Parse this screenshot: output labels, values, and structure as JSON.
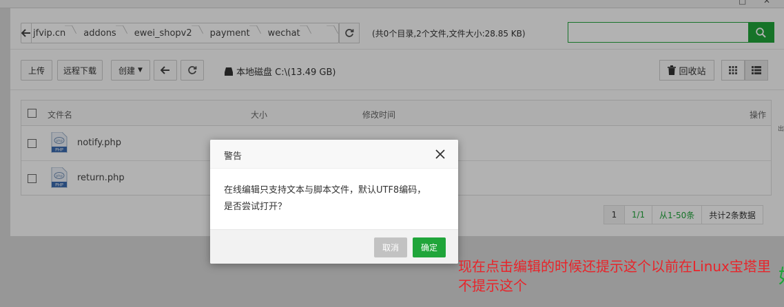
{
  "window": {
    "controls": [
      "□",
      "✕"
    ]
  },
  "path": {
    "crumbs": [
      "jfvip.cn",
      "addons",
      "ewei_shopv2",
      "payment",
      "wechat"
    ],
    "info": "(共0个目录,2个文件,文件大小:28.85 KB)",
    "search_placeholder": ""
  },
  "toolbar": {
    "upload": "上传",
    "remote_download": "远程下载",
    "create": "创建",
    "disk": "本地磁盘 C:\\(13.49 GB)",
    "recycle": "回收站"
  },
  "table": {
    "headers": {
      "name": "文件名",
      "size": "大小",
      "mtime": "修改时间",
      "ops": "操作"
    },
    "rows": [
      {
        "name": "notify.php"
      },
      {
        "name": "return.php"
      }
    ]
  },
  "pager": {
    "page": "1",
    "pages": "1/1",
    "range": "从1-50条",
    "total": "共计2条数据"
  },
  "dialog": {
    "title": "警告",
    "message_line1": "在线编辑只支持文本与脚本文件，默认UTF8编码，",
    "message_line2": "是否尝试打开？",
    "cancel": "取消",
    "ok": "确定"
  },
  "annotation": "现在点击编辑的时候还提示这个以前在Linux宝塔里不提示这个",
  "edge_text": {
    "right_large": "好",
    "right_small": "出"
  },
  "colors": {
    "accent": "#20a53a",
    "annotation": "#e8242a",
    "cancel": "#c2c2c2"
  }
}
